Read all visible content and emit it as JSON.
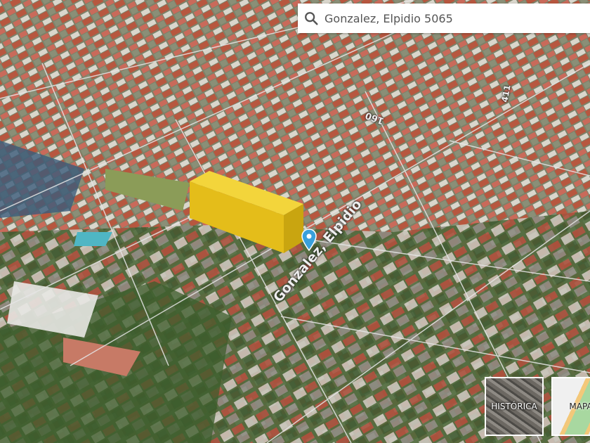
{
  "search": {
    "value": "Gonzalez, Elpidio 5065",
    "icon": "search-icon"
  },
  "map": {
    "streets": {
      "main": "Gonzalez, Elpidio",
      "number_a": "160",
      "number_b": "411"
    },
    "building_color": "#e9c21a",
    "marker_color": "#3aa0dc"
  },
  "layers": {
    "historic": "HISTÓRICA",
    "map": "MAPA"
  }
}
